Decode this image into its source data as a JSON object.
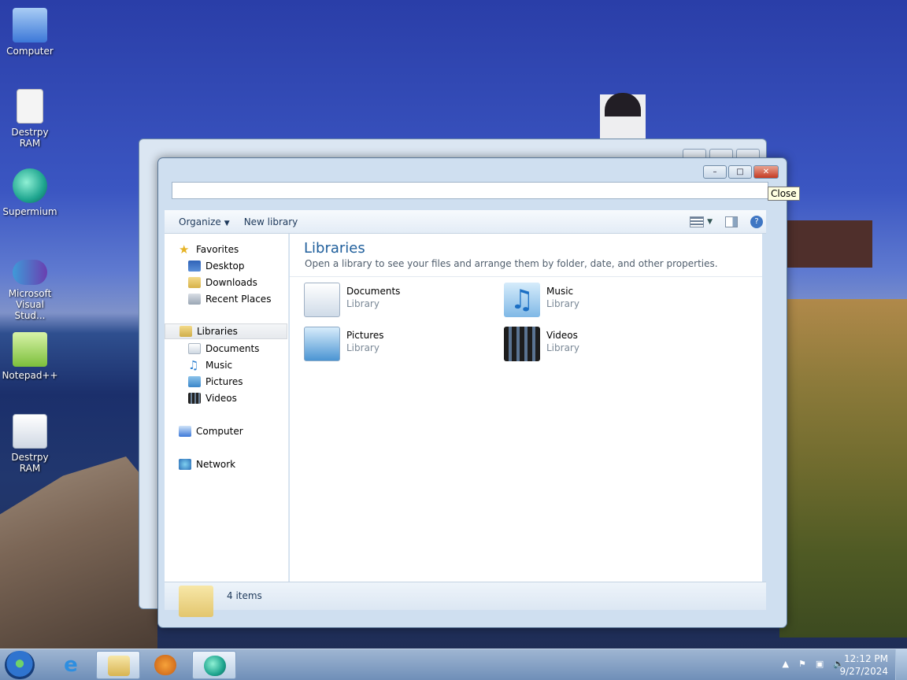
{
  "desktop": {
    "icons": [
      {
        "label": "Computer",
        "icon": "computer-icon",
        "color": "#3c78d8"
      },
      {
        "label": "Destrpy RAM",
        "icon": "file-icon",
        "color": "#f1f1f1"
      },
      {
        "label": "Supermium",
        "icon": "supermium-icon",
        "color": "#1ea58f"
      },
      {
        "label": "Microsoft Visual Stud...",
        "icon": "visual-studio-icon",
        "color": "#6a3fb0"
      },
      {
        "label": "Notepad++",
        "icon": "notepadpp-icon",
        "color": "#7cbf3b"
      },
      {
        "label": "Destrpy RAM",
        "icon": "settings-file-icon",
        "color": "#d0d8e4"
      }
    ]
  },
  "window": {
    "tooltip": "Close",
    "toolbar": {
      "organize": "Organize",
      "new_library": "New library"
    },
    "nav": {
      "favorites": "Favorites",
      "desktop": "Desktop",
      "downloads": "Downloads",
      "recent_places": "Recent Places",
      "libraries": "Libraries",
      "documents": "Documents",
      "music": "Music",
      "pictures": "Pictures",
      "videos": "Videos",
      "computer": "Computer",
      "network": "Network"
    },
    "content": {
      "title": "Libraries",
      "subtitle": "Open a library to see your files and arrange them by folder, date, and other properties.",
      "items": [
        {
          "name": "Documents",
          "type": "Library"
        },
        {
          "name": "Music",
          "type": "Library"
        },
        {
          "name": "Pictures",
          "type": "Library"
        },
        {
          "name": "Videos",
          "type": "Library"
        }
      ]
    },
    "status": {
      "count": "4 items"
    }
  },
  "taskbar": {
    "time": "12:12 PM",
    "date": "9/27/2024"
  },
  "colors": {
    "accent_title": "#1e5e9b",
    "close_button": "#c43a22",
    "taskbar": "#7f9dc2"
  }
}
